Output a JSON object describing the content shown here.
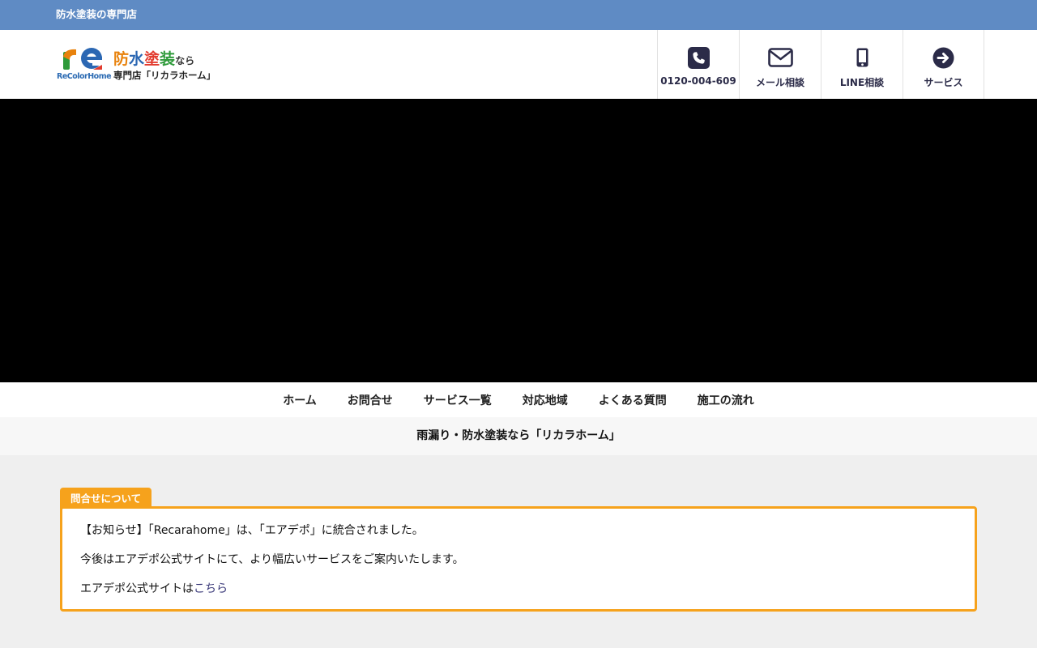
{
  "topbar": {
    "text": "防水塗装の専門店"
  },
  "logo": {
    "sub_text": "ReColorHome",
    "main_parts": [
      "防",
      "水",
      "塗",
      "装"
    ],
    "main_colors": [
      "#e8820c",
      "#2b67b3",
      "#e23b2e",
      "#2e9a3a"
    ],
    "main_suffix": "なら",
    "tagline": "専門店「リカラホーム」"
  },
  "header_nav": [
    {
      "label": "0120-004-609",
      "icon": "phone-icon"
    },
    {
      "label": "メール相談",
      "icon": "mail-icon"
    },
    {
      "label": "LINE相談",
      "icon": "mobile-icon"
    },
    {
      "label": "サービス",
      "icon": "arrow-right-circle-icon"
    }
  ],
  "global_nav": [
    "ホーム",
    "お問合せ",
    "サービス一覧",
    "対応地域",
    "よくある質問",
    "施工の流れ"
  ],
  "tagline": "雨漏り・防水塗装なら「リカラホーム」",
  "notice": {
    "tab_label": "問合せについて",
    "line1": "【お知らせ】「Recarahome」は、「エアデポ」に統合されました。",
    "line2": "今後はエアデポ公式サイトにて、より幅広いサービスをご案内いたします。",
    "line3_prefix": "エアデポ公式サイトは",
    "line3_link": "こちら"
  },
  "colors": {
    "topbar": "#5f8bc4",
    "accent_orange": "#f6a21c",
    "icon_navy": "#2b2b48",
    "link": "#3b3a7a"
  }
}
